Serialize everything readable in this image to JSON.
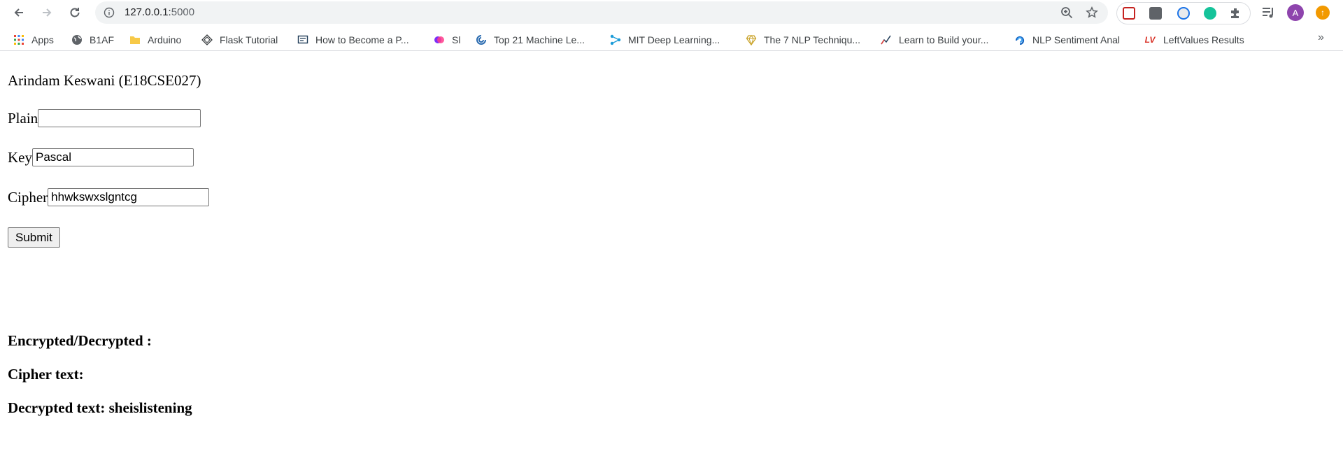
{
  "browser": {
    "url_host": "127.0.0.1:",
    "url_port": "5000",
    "profile_initial": "A"
  },
  "bookmarks": [
    {
      "label": "Apps",
      "icon": "apps-grid-icon"
    },
    {
      "label": "B1AF",
      "icon": "globe-icon"
    },
    {
      "label": "Arduino",
      "icon": "folder-icon"
    },
    {
      "label": "Flask Tutorial",
      "icon": "diamond-icon"
    },
    {
      "label": "How to Become a P...",
      "icon": "laptop-icon"
    },
    {
      "label": "Sl",
      "icon": "circles-icon"
    },
    {
      "label": "Top 21 Machine Le...",
      "icon": "swirl-icon"
    },
    {
      "label": "MIT Deep Learning...",
      "icon": "network-icon"
    },
    {
      "label": "The 7 NLP Techniqu...",
      "icon": "heart-gem-icon"
    },
    {
      "label": "Learn to Build your...",
      "icon": "trend-icon"
    },
    {
      "label": "NLP Sentiment Anal",
      "icon": "loop-icon"
    },
    {
      "label": "LeftValues Results",
      "icon": "lv-icon"
    }
  ],
  "page": {
    "author": "Arindam Keswani (E18CSE027)",
    "plain_label": "Plain",
    "plain_value": "",
    "key_label": "Key",
    "key_value": "Pascal",
    "cipher_label": "Cipher",
    "cipher_value": "hhwkswxslgntcg",
    "submit_label": "Submit",
    "result_heading": "Encrypted/Decrypted :",
    "cipher_text_label": "Cipher text:",
    "decrypted_text_label": "Decrypted text: sheislistening"
  },
  "colors": {
    "apps_red": "#ea4335",
    "apps_blue": "#4285f4",
    "apps_yellow": "#fbbc05",
    "apps_green": "#34a853",
    "avatar": "#8e44ad",
    "update": "#f29900",
    "lv_red": "#d93025"
  }
}
